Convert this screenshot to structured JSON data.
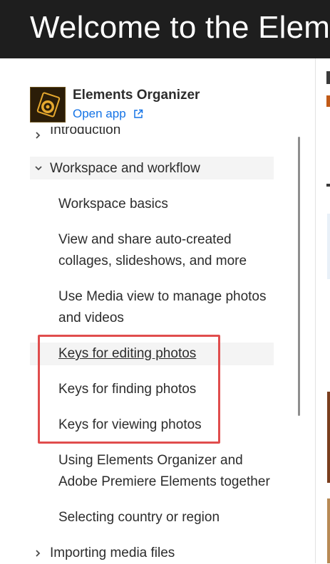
{
  "header": {
    "title": "Welcome to the Elements Organizer"
  },
  "app": {
    "name": "Elements Organizer",
    "open_link": "Open app",
    "icon": "elements-organizer-icon",
    "brand_color": "#e6a92f"
  },
  "nav": {
    "introduction": "Introduction",
    "workspace_section": "Workspace and workflow",
    "items": [
      "Workspace basics",
      "View and share auto-created collages, slideshows, and more",
      "Use Media view to manage photos and videos",
      "Keys for editing photos",
      "Keys for finding photos",
      "Keys for viewing photos",
      "Using Elements Organizer and Adobe Premiere Elements together",
      "Selecting country or region"
    ],
    "importing": "Importing media files"
  },
  "colors": {
    "header_bg": "#1e1e1e",
    "link": "#1473e6",
    "highlight_box": "#e04d4d"
  }
}
